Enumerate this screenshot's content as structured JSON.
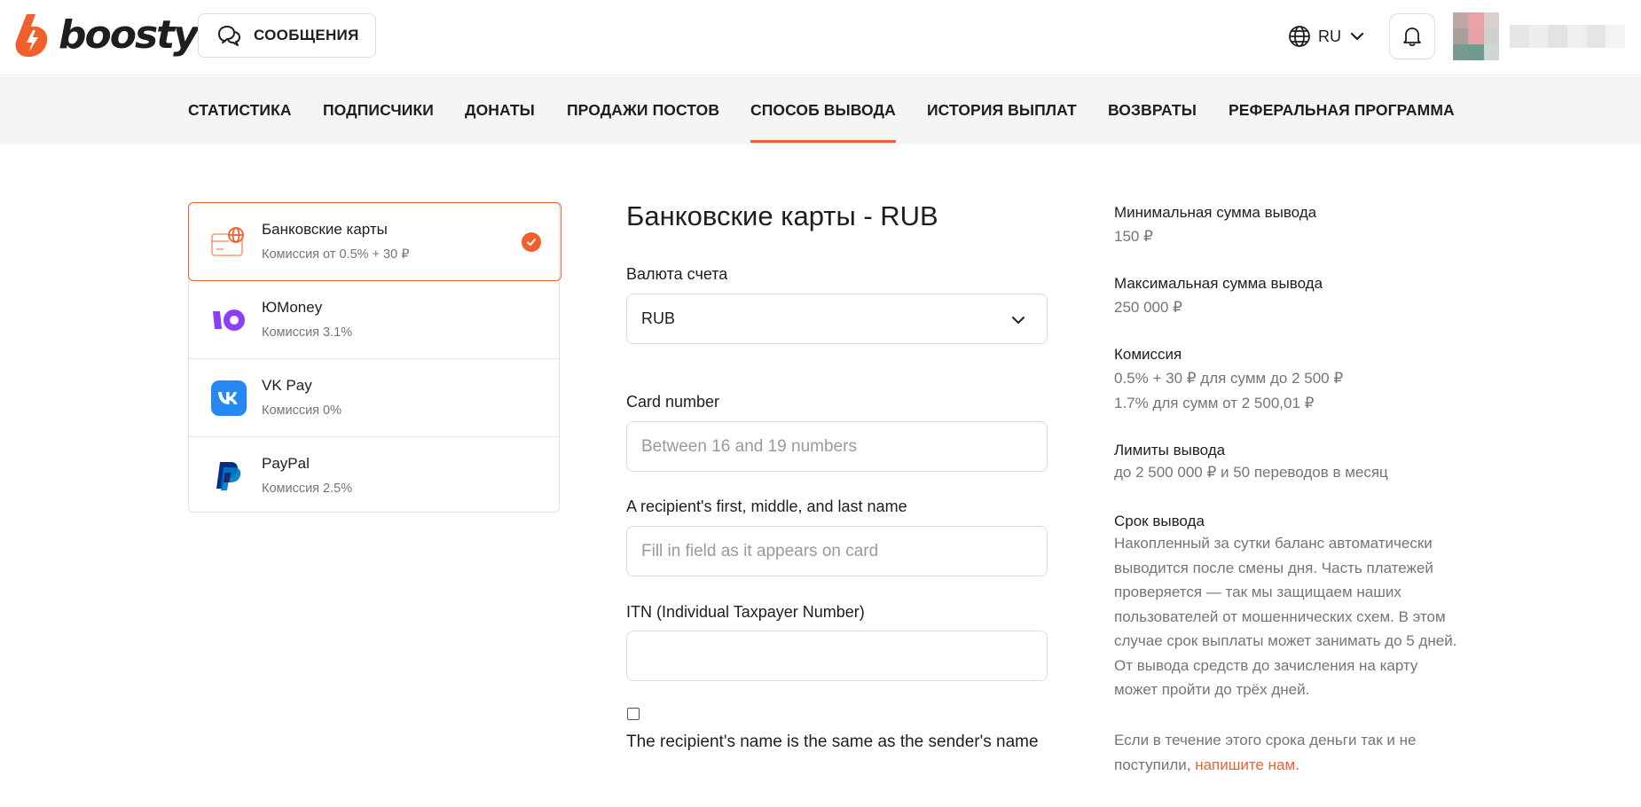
{
  "header": {
    "logo_text": "boosty",
    "messages_label": "СООБЩЕНИЯ",
    "language_label": "RU",
    "brand_color": "#f15f2c"
  },
  "tabs": [
    {
      "label": "СТАТИСТИКА",
      "active": false
    },
    {
      "label": "ПОДПИСЧИКИ",
      "active": false
    },
    {
      "label": "ДОНАТЫ",
      "active": false
    },
    {
      "label": "ПРОДАЖИ ПОСТОВ",
      "active": false
    },
    {
      "label": "СПОСОБ ВЫВОДА",
      "active": true
    },
    {
      "label": "ИСТОРИЯ ВЫПЛАТ",
      "active": false
    },
    {
      "label": "ВОЗВРАТЫ",
      "active": false
    },
    {
      "label": "РЕФЕРАЛЬНАЯ ПРОГРАММА",
      "active": false
    }
  ],
  "methods": [
    {
      "title": "Банковские карты",
      "subtitle": "Комиссия от 0.5% + 30 ₽",
      "icon": "bank-card-globe-icon",
      "selected": true
    },
    {
      "title": "ЮMoney",
      "subtitle": "Комиссия 3.1%",
      "icon": "yoomoney-icon",
      "selected": false
    },
    {
      "title": "VK Pay",
      "subtitle": "Комиссия 0%",
      "icon": "vk-icon",
      "selected": false
    },
    {
      "title": "PayPal",
      "subtitle": "Комиссия 2.5%",
      "icon": "paypal-icon",
      "selected": false
    }
  ],
  "form": {
    "title": "Банковские карты - RUB",
    "currency_label": "Валюта счета",
    "currency_value": "RUB",
    "card_label": "Card number",
    "card_placeholder": "Between 16 and 19 numbers",
    "name_label": "A recipient's first, middle, and last name",
    "name_placeholder": "Fill in field as it appears on card",
    "itn_label": "ITN (Individual Taxpayer Number)",
    "itn_value": "",
    "same_name_checked": false,
    "same_name_label": "The recipient's name is the same as the sender's name"
  },
  "info": {
    "min_label": "Минимальная сумма вывода",
    "min_value": "150 ₽",
    "max_label": "Максимальная сумма вывода",
    "max_value": "250 000 ₽",
    "fee_label": "Комиссия",
    "fee_line1": "0.5% + 30 ₽ для сумм до 2 500 ₽",
    "fee_line2": "1.7% для сумм от 2 500,01 ₽",
    "limits_label": "Лимиты вывода",
    "limits_value": "до 2 500 000 ₽ и 50 переводов в месяц",
    "term_label": "Срок вывода",
    "term_value": "Накопленный за сутки баланс автоматически выводится после смены дня. Часть платежей проверяется — так мы защищаем наших пользователей от мошеннических схем. В этом случае срок выплаты может занимать до 5 дней. От вывода средств до зачисления на карту может пройти до трёх дней.",
    "contact_prefix": "Если в течение этого срока деньги так и не поступили, ",
    "contact_link": "напишите нам",
    "contact_suffix": "."
  }
}
